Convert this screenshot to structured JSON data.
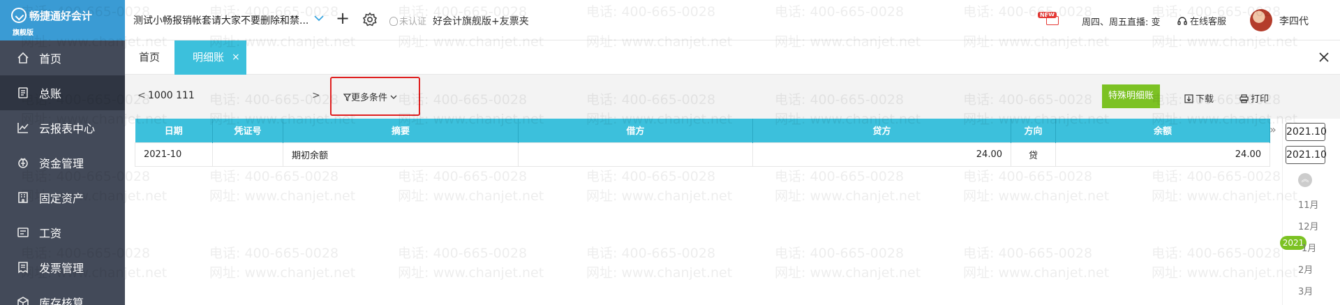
{
  "brand": {
    "title": "畅捷通好会计",
    "subtitle": "旗舰版"
  },
  "sidebar": {
    "items": [
      {
        "label": "首页",
        "icon": "home-icon"
      },
      {
        "label": "总账",
        "icon": "ledger-icon",
        "active": true
      },
      {
        "label": "云报表中心",
        "icon": "chart-icon"
      },
      {
        "label": "资金管理",
        "icon": "money-icon"
      },
      {
        "label": "固定资产",
        "icon": "asset-icon"
      },
      {
        "label": "工资",
        "icon": "salary-icon"
      },
      {
        "label": "发票管理",
        "icon": "invoice-icon"
      },
      {
        "label": "库存核算",
        "icon": "inventory-icon"
      }
    ]
  },
  "header": {
    "account_set": "测试小畅报销帐套请大家不要删除和禁...",
    "add_symbol": "+",
    "unverified": "未认证",
    "edition": "好会计旗舰版+友票夹",
    "new_badge": "NEW",
    "live_text": "周四、周五直播: 变",
    "service": "在线客服",
    "user": "李四代"
  },
  "tabs": [
    {
      "label": "首页"
    },
    {
      "label": "明细账",
      "active": true,
      "close": "×"
    }
  ],
  "toolbar": {
    "prev": "<",
    "account_code": "1000 111",
    "next": ">",
    "more_conditions": "更多条件",
    "special_detail": "特殊明细账",
    "download": "下载",
    "print": "打印"
  },
  "table": {
    "columns": [
      "日期",
      "凭证号",
      "摘要",
      "借方",
      "贷方",
      "方向",
      "余额"
    ],
    "rows": [
      {
        "date": "2021-10",
        "voucher": "",
        "summary": "期初余额",
        "debit": "",
        "credit": "24.00",
        "direction": "贷",
        "balance": "24.00"
      }
    ]
  },
  "collapse_symbol": "»",
  "period": {
    "start": "2021.10",
    "end": "2021.10",
    "up_symbol": "︽",
    "months_above": [
      "11月",
      "12月"
    ],
    "year": "2021",
    "months_below": [
      "1月",
      "2月",
      "3月"
    ]
  },
  "watermark": {
    "phone": "电话: 400-665-0028",
    "site": "网址: www.chanjet.net"
  },
  "colors": {
    "sidebar": "#434a59",
    "logo": "#3a9bd4",
    "accent": "#3cc0dc",
    "green": "#7cc223",
    "highlight": "#e02020"
  }
}
